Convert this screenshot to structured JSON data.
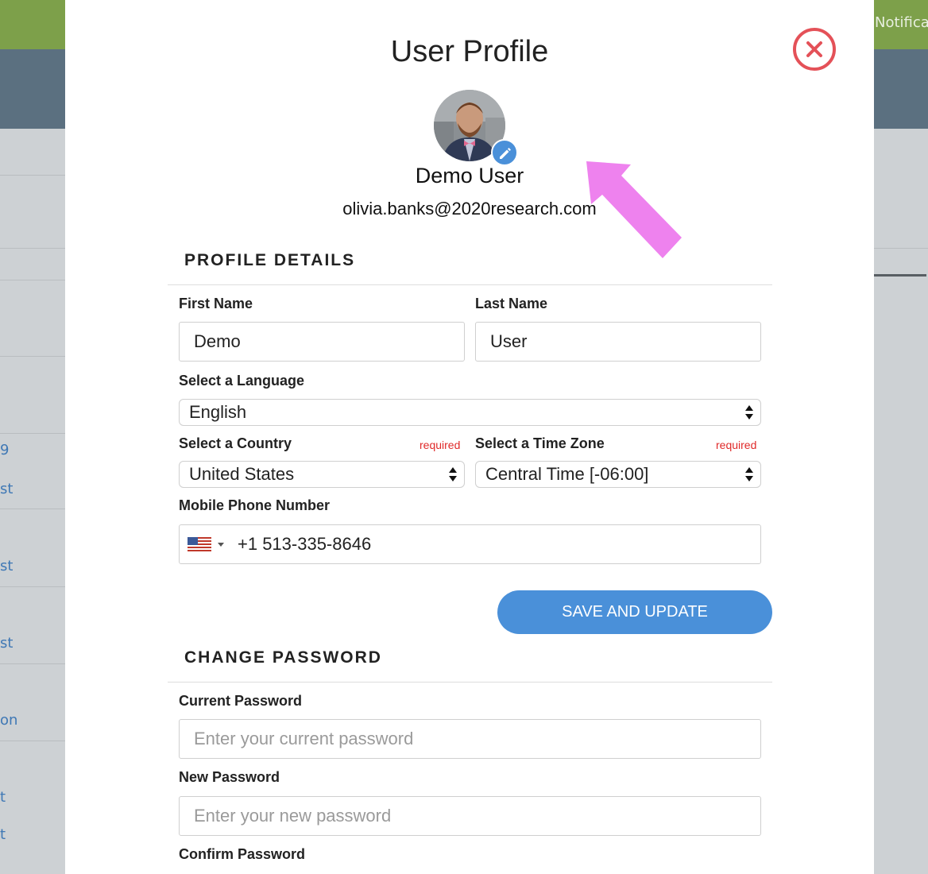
{
  "background": {
    "notifications_label": "Notifica",
    "link_fragments": [
      "9",
      "st",
      "st",
      "st",
      "on",
      "t",
      "t"
    ]
  },
  "modal": {
    "title": "User Profile",
    "user": {
      "name": "Demo User",
      "email": "olivia.banks@2020research.com"
    },
    "profile_details": {
      "heading": "PROFILE DETAILS",
      "first_name_label": "First Name",
      "first_name_value": "Demo",
      "last_name_label": "Last Name",
      "last_name_value": "User",
      "language_label": "Select a Language",
      "language_value": "English",
      "country_label": "Select a Country",
      "country_required": "required",
      "country_value": "United States",
      "timezone_label": "Select a Time Zone",
      "timezone_required": "required",
      "timezone_value": "Central Time [-06:00]",
      "phone_label": "Mobile Phone Number",
      "phone_value": "+1 513-335-8646",
      "save_button": "SAVE AND UPDATE"
    },
    "change_password": {
      "heading": "CHANGE PASSWORD",
      "current_label": "Current Password",
      "current_placeholder": "Enter your current password",
      "new_label": "New Password",
      "new_placeholder": "Enter your new password",
      "confirm_label": "Confirm Password"
    }
  },
  "colors": {
    "accent": "#4a90d9",
    "close": "#e45158",
    "required": "#e02a2a",
    "annotation_arrow": "#ee82ee"
  },
  "icons": [
    "close-icon",
    "edit-pencil-icon",
    "us-flag-icon",
    "select-caret-icon"
  ]
}
